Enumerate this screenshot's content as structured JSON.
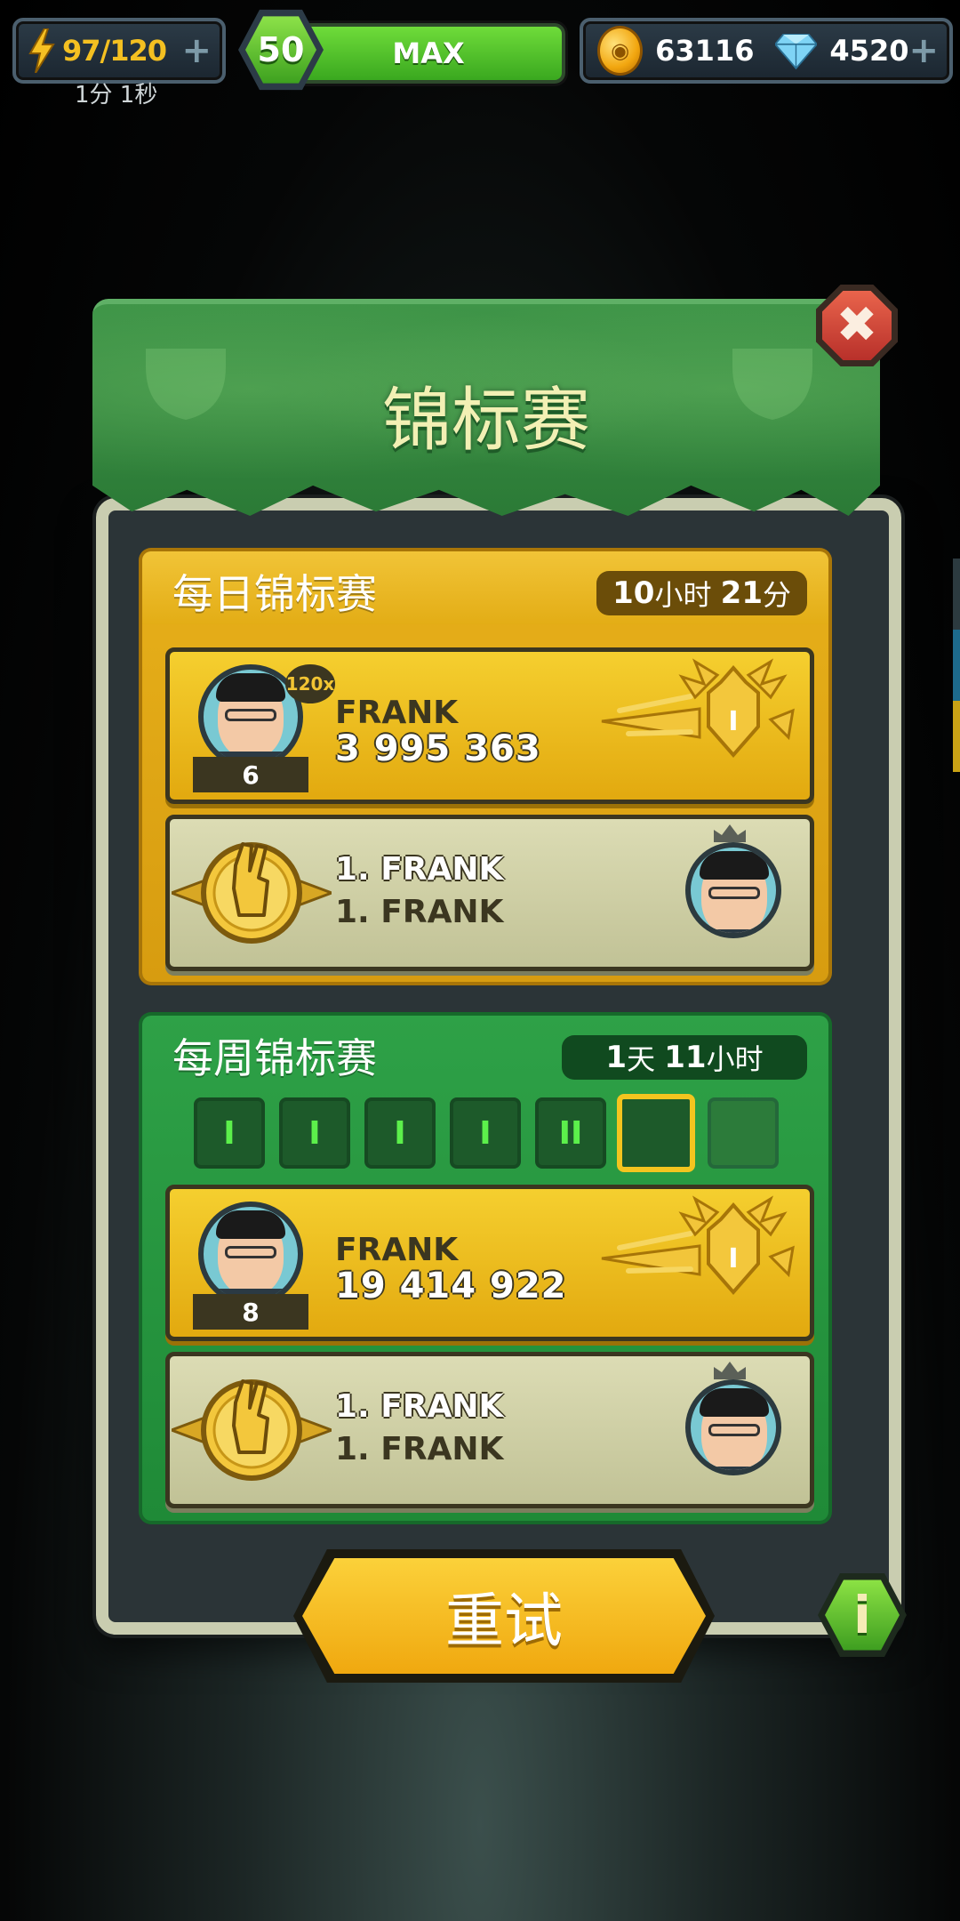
{
  "topbar": {
    "energy": "97/120",
    "energy_timer": "1分 1秒",
    "level": "50",
    "xp_label": "MAX",
    "coins": "63116",
    "gems": "4520"
  },
  "dialog": {
    "title": "锦标赛"
  },
  "daily": {
    "title": "每日锦标赛",
    "timer_num1": "10",
    "timer_unit1": "小时",
    "timer_num2": "21",
    "timer_unit2": "分",
    "player": {
      "name": "FRANK",
      "score": "3 995 363",
      "rank": "6",
      "multiplier": "120x",
      "trophy_rank": "I"
    },
    "leader": {
      "line1": "1. FRANK",
      "line2": "1. FRANK"
    }
  },
  "weekly": {
    "title": "每周锦标赛",
    "timer_num1": "1",
    "timer_unit1": "天",
    "timer_num2": "11",
    "timer_unit2": "小时",
    "days": [
      "I",
      "I",
      "I",
      "I",
      "II",
      "",
      ""
    ],
    "player": {
      "name": "FRANK",
      "score": "19 414 922",
      "rank": "8",
      "trophy_rank": "I"
    },
    "leader": {
      "line1": "1. FRANK",
      "line2": "1. FRANK"
    }
  },
  "buttons": {
    "retry": "重试",
    "info": "i",
    "close": "✖"
  },
  "colors": {
    "daily": "#e3ad16",
    "weekly": "#2ea147",
    "accent_green": "#5cf04b"
  }
}
